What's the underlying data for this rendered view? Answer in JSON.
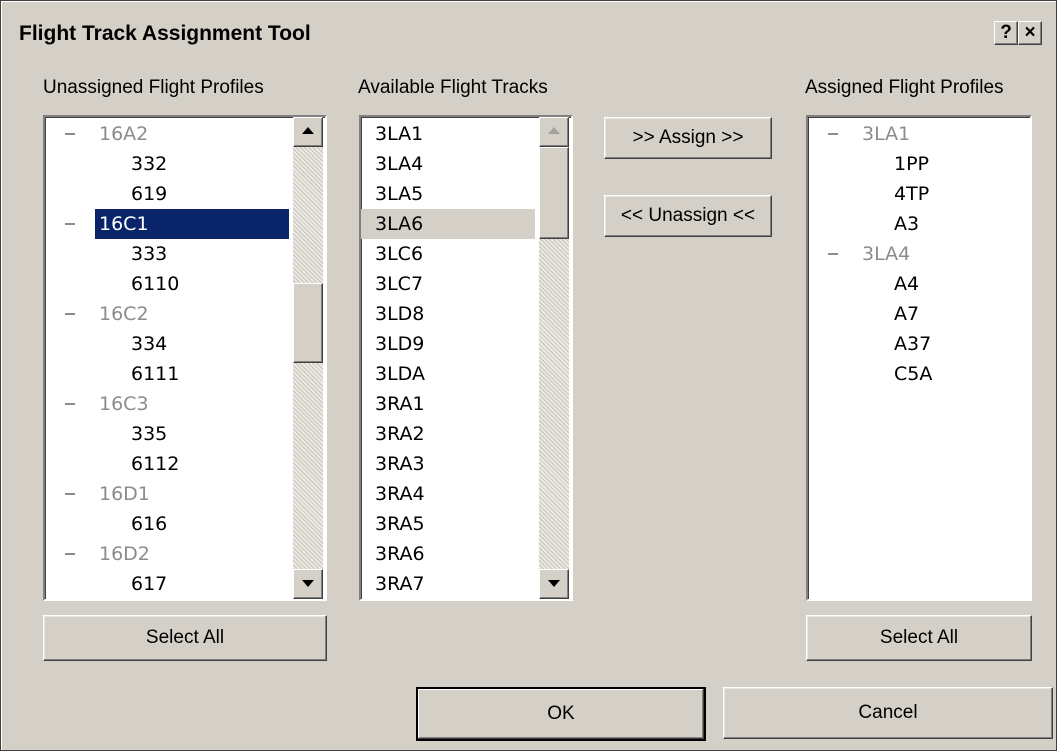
{
  "window": {
    "title": "Flight Track Assignment Tool",
    "help_label": "?",
    "close_label": "×"
  },
  "unassigned": {
    "label": "Unassigned Flight Profiles",
    "rows": [
      {
        "text": "16A2",
        "kind": "group"
      },
      {
        "text": "332",
        "kind": "child"
      },
      {
        "text": "619",
        "kind": "child"
      },
      {
        "text": "16C1",
        "kind": "group",
        "selected": true
      },
      {
        "text": "333",
        "kind": "child"
      },
      {
        "text": "6110",
        "kind": "child"
      },
      {
        "text": "16C2",
        "kind": "group"
      },
      {
        "text": "334",
        "kind": "child"
      },
      {
        "text": "6111",
        "kind": "child"
      },
      {
        "text": "16C3",
        "kind": "group"
      },
      {
        "text": "335",
        "kind": "child"
      },
      {
        "text": "6112",
        "kind": "child"
      },
      {
        "text": "16D1",
        "kind": "group"
      },
      {
        "text": "616",
        "kind": "child"
      },
      {
        "text": "16D2",
        "kind": "group"
      },
      {
        "text": "617",
        "kind": "child"
      }
    ],
    "select_all_label": "Select All"
  },
  "available": {
    "label": "Available Flight Tracks",
    "items": [
      "3LA1",
      "3LA4",
      "3LA5",
      "3LA6",
      "3LC6",
      "3LC7",
      "3LD8",
      "3LD9",
      "3LDA",
      "3RA1",
      "3RA2",
      "3RA3",
      "3RA4",
      "3RA5",
      "3RA6",
      "3RA7"
    ],
    "selected_index": 3
  },
  "actions": {
    "assign_label": ">> Assign >>",
    "unassign_label": "<< Unassign <<"
  },
  "assigned": {
    "label": "Assigned Flight Profiles",
    "rows": [
      {
        "text": "3LA1",
        "kind": "group"
      },
      {
        "text": "1PP",
        "kind": "child"
      },
      {
        "text": "4TP",
        "kind": "child"
      },
      {
        "text": "A3",
        "kind": "child"
      },
      {
        "text": "3LA4",
        "kind": "group"
      },
      {
        "text": "A4",
        "kind": "child"
      },
      {
        "text": "A7",
        "kind": "child"
      },
      {
        "text": "A37",
        "kind": "child"
      },
      {
        "text": "C5A",
        "kind": "child"
      }
    ],
    "select_all_label": "Select All"
  },
  "footer": {
    "ok_label": "OK",
    "cancel_label": "Cancel"
  },
  "colors": {
    "dialog_bg": "#d4d0c8",
    "selection_navy": "#0a246a",
    "group_grey": "#8c8c8c"
  }
}
